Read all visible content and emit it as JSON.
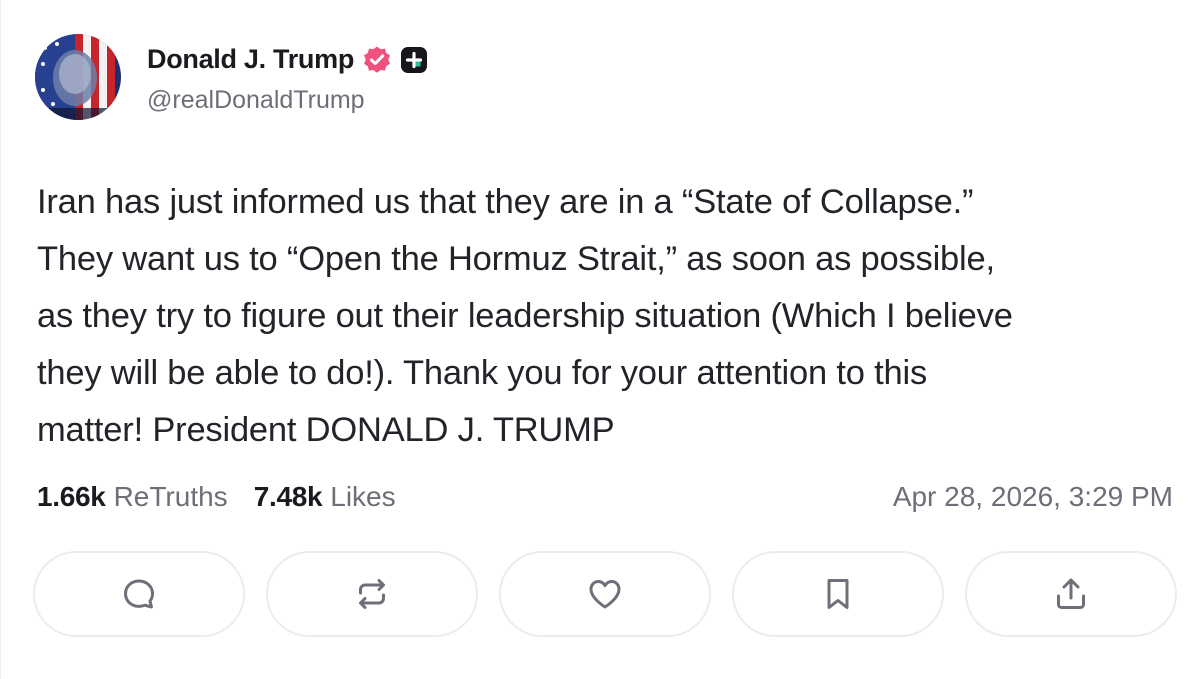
{
  "post": {
    "author": {
      "display_name": "Donald J. Trump",
      "handle": "@realDonaldTrump"
    },
    "body_lines": [
      "Iran has just informed us that they are in a “State of Collapse.”",
      "They want us to “Open the Hormuz Strait,” as soon as possible,",
      "as they try to figure out their leadership situation (Which I believe",
      "they will be able to do!). Thank you for your attention to this",
      "matter! President DONALD J. TRUMP"
    ],
    "stats": {
      "retruths_count": "1.66k",
      "retruths_label": "ReTruths",
      "likes_count": "7.48k",
      "likes_label": "Likes"
    },
    "timestamp": "Apr 28, 2026, 3:29 PM"
  },
  "icons": {
    "avatar": "portrait-avatar",
    "verified": "verified-badge-icon",
    "plus": "plus-badge-icon",
    "reply": "reply-icon",
    "retruth": "retruth-icon",
    "like": "heart-icon",
    "bookmark": "bookmark-icon",
    "share": "share-icon"
  },
  "colors": {
    "verified": "#f0507c",
    "text": "#23232a",
    "muted": "#6e6e78",
    "icon": "#6f6f7a",
    "border": "#ececf0"
  }
}
